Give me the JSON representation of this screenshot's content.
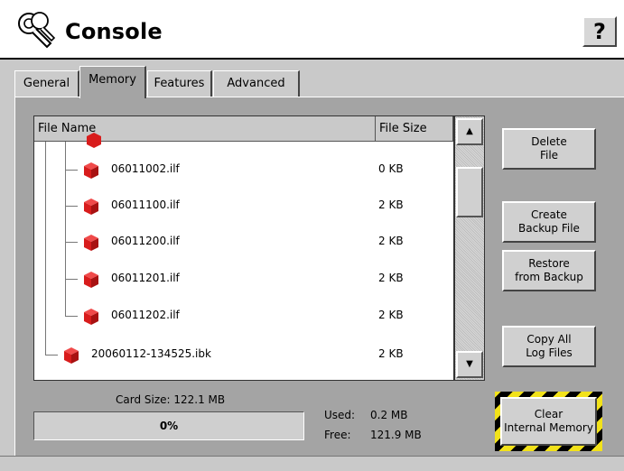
{
  "window": {
    "title": "Console",
    "help_label": "?"
  },
  "tabs": [
    {
      "label": "General",
      "active": false
    },
    {
      "label": "Memory",
      "active": true
    },
    {
      "label": "Features",
      "active": false
    },
    {
      "label": "Advanced",
      "active": false
    }
  ],
  "file_list": {
    "columns": {
      "name": "File Name",
      "size": "File Size"
    },
    "rows": [
      {
        "name": "06011002.ilf",
        "size": "0 KB"
      },
      {
        "name": "06011100.ilf",
        "size": "2 KB"
      },
      {
        "name": "06011200.ilf",
        "size": "2 KB"
      },
      {
        "name": "06011201.ilf",
        "size": "2 KB"
      },
      {
        "name": "06011202.ilf",
        "size": "2 KB"
      },
      {
        "name": "20060112-134525.ibk",
        "size": "2 KB"
      }
    ],
    "scroll": {
      "up_label": "▲",
      "down_label": "▼"
    }
  },
  "actions": {
    "delete": "Delete\nFile",
    "create_backup": "Create\nBackup File",
    "restore": "Restore\nfrom Backup",
    "copy_logs": "Copy All\nLog Files",
    "clear_memory": "Clear\nInternal Memory"
  },
  "card": {
    "size_label": "Card Size:",
    "size_value": "122.1 MB",
    "usage_percent": 0,
    "usage_text": "0%",
    "used_label": "Used:",
    "used_value": "0.2 MB",
    "free_label": "Free:",
    "free_value": "121.9 MB"
  },
  "colors": {
    "file_icon": "#d81c1c",
    "warning_stripe": "#f2e21a",
    "panel": "#a4a4a4"
  },
  "icons": {
    "title": "wrench-keys-icon",
    "file": "red-cube-file-icon"
  }
}
